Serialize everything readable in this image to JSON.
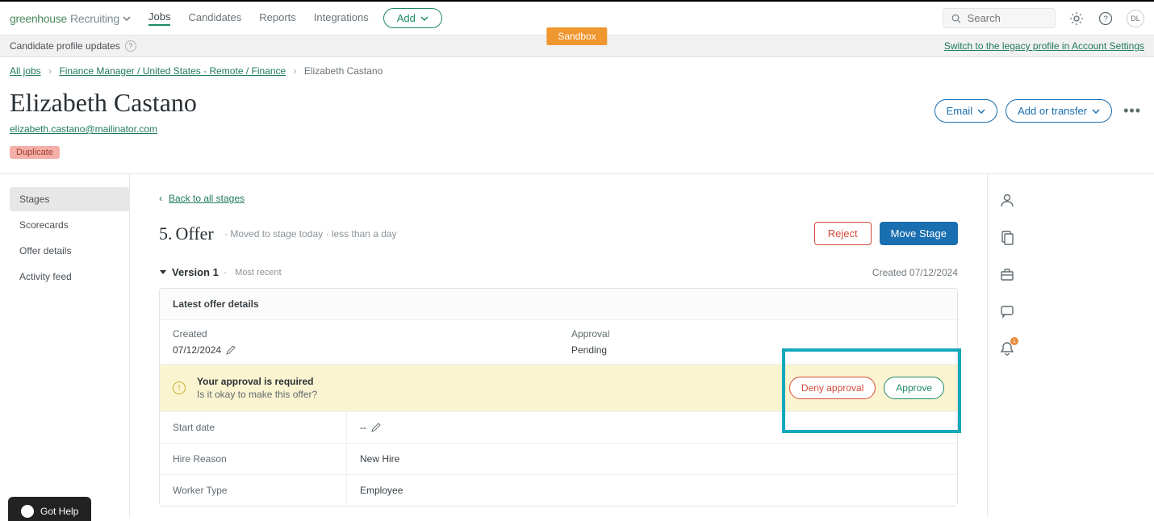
{
  "brand": {
    "green": "greenhouse",
    "grey": "Recruiting"
  },
  "nav": {
    "jobs": "Jobs",
    "candidates": "Candidates",
    "reports": "Reports",
    "integrations": "Integrations",
    "add": "Add"
  },
  "sandbox": "Sandbox",
  "search": {
    "placeholder": "Search"
  },
  "avatar_initials": "DL",
  "update_bar": {
    "label": "Candidate profile updates",
    "legacy": "Switch to the legacy profile in Account Settings"
  },
  "breadcrumb": {
    "all_jobs": "All jobs",
    "job": "Finance Manager / United States - Remote / Finance",
    "current": "Elizabeth Castano"
  },
  "profile": {
    "name": "Elizabeth Castano",
    "email": "elizabeth.castano@mailinator.com",
    "duplicate": "Duplicate",
    "email_btn": "Email",
    "transfer_btn": "Add or transfer"
  },
  "sidebar": {
    "stages": "Stages",
    "scorecards": "Scorecards",
    "offer_details": "Offer details",
    "activity": "Activity feed"
  },
  "content": {
    "back": "Back to all stages",
    "stage_num": "5.",
    "stage_name": "Offer",
    "moved": "Moved to stage today",
    "duration": "less than a day",
    "reject": "Reject",
    "move": "Move Stage",
    "version": "Version 1",
    "most_recent": "Most recent",
    "created_label": "Created 07/12/2024",
    "card_title": "Latest offer details",
    "created_field": "Created",
    "created_value": "07/12/2024",
    "approval_field": "Approval",
    "approval_value": "Pending",
    "banner_title": "Your approval is required",
    "banner_sub": "Is it okay to make this offer?",
    "deny": "Deny approval",
    "approve": "Approve",
    "rows": {
      "start_date": {
        "label": "Start date",
        "value": "--"
      },
      "hire_reason": {
        "label": "Hire Reason",
        "value": "New Hire"
      },
      "worker_type": {
        "label": "Worker Type",
        "value": "Employee"
      }
    }
  },
  "help_widget": "Got Help",
  "notif_count": "1"
}
